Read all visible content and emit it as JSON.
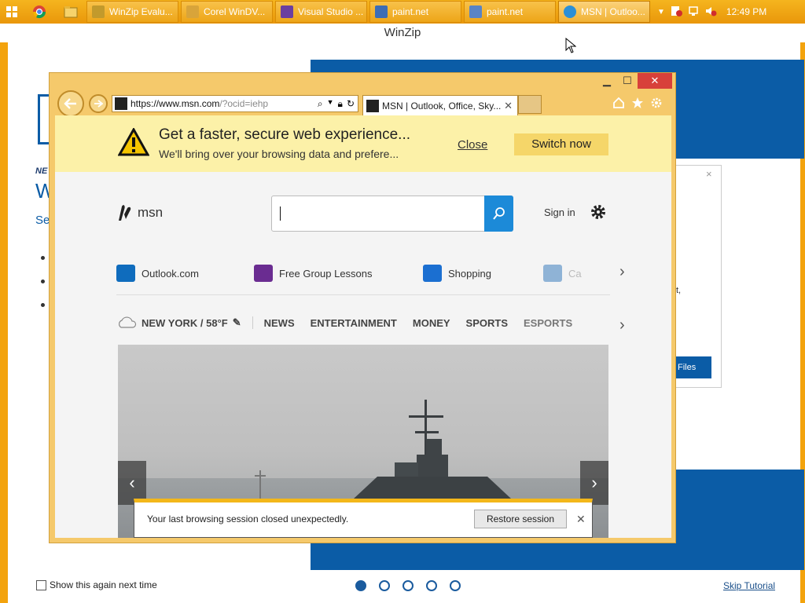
{
  "taskbar": {
    "buttons": [
      {
        "label": "WinZip Evalu..."
      },
      {
        "label": "Corel WinDV..."
      },
      {
        "label": "Visual Studio ..."
      },
      {
        "label": "paint.net"
      },
      {
        "label": "paint.net"
      },
      {
        "label": "MSN | Outloo..."
      }
    ],
    "clock": "12:49 PM",
    "colors": {
      "bar": "#f0a30a"
    }
  },
  "winzip": {
    "title": "WinZip",
    "new_label": "NE",
    "heading_fragment": "W",
    "sub_fragment": "Se",
    "card_text": "t,",
    "files_button": "Files",
    "show_again": "Show this again next time",
    "skip": "Skip Tutorial",
    "colors": {
      "blue": "#0b5ca6"
    }
  },
  "ie": {
    "url_main": "https://www.msn.com",
    "url_rest": "/?ocid=iehp",
    "tab_title": "MSN | Outlook, Office, Sky...",
    "notify": {
      "headline": "Get a faster, secure web experience...",
      "sub": "We'll bring over your browsing data and prefere...",
      "close": "Close",
      "switch": "Switch now"
    },
    "msn": {
      "logo": "msn",
      "signin": "Sign in",
      "links": [
        "Outlook.com",
        "Free Group Lessons",
        "Shopping",
        "Ca"
      ],
      "weather": "NEW YORK / 58°F",
      "nav": [
        "NEWS",
        "ENTERTAINMENT",
        "MONEY",
        "SPORTS",
        "ESPORTS"
      ]
    },
    "restore": {
      "text": "Your last browsing session closed unexpectedly.",
      "button": "Restore session"
    }
  }
}
